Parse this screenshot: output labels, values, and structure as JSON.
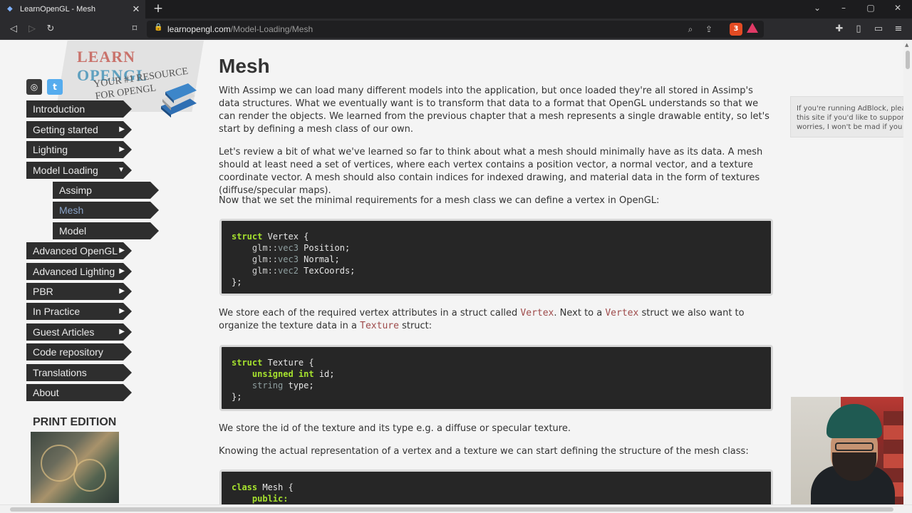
{
  "browser": {
    "tab_title": "LearnOpenGL - Mesh",
    "tab_close": "✕",
    "new_tab": "+",
    "url_domain": "learnopengl.com",
    "url_path": "/Model-Loading/Mesh",
    "brave_count": "3",
    "icons": [
      "back-icon",
      "forward-icon",
      "reload-icon",
      "bookmark-icon",
      "lock-icon",
      "zoom-icon",
      "share-icon",
      "brave-shields-icon",
      "rewards-icon",
      "extensions-icon",
      "sidebar-icon",
      "wallet-icon",
      "menu-icon"
    ]
  },
  "site": {
    "logo_learn": "LEARN ",
    "logo_opengl": "OPENGL",
    "logo_tagline_1": "YOUR #1 RESOURCE",
    "logo_tagline_2": "FOR OPENGL",
    "github_icon": "github-icon",
    "twitter_icon": "twitter-icon"
  },
  "nav": {
    "items": [
      {
        "label": "Introduction",
        "arrow": ""
      },
      {
        "label": "Getting started",
        "arrow": "▶"
      },
      {
        "label": "Lighting",
        "arrow": "▶"
      },
      {
        "label": "Model Loading",
        "arrow": "▼"
      },
      {
        "label": "Assimp",
        "arrow": ""
      },
      {
        "label": "Mesh",
        "arrow": ""
      },
      {
        "label": "Model",
        "arrow": ""
      },
      {
        "label": "Advanced OpenGL",
        "arrow": "▶"
      },
      {
        "label": "Advanced Lighting",
        "arrow": "▶"
      },
      {
        "label": "PBR",
        "arrow": "▶"
      },
      {
        "label": "In Practice",
        "arrow": "▶"
      },
      {
        "label": "Guest Articles",
        "arrow": "▶"
      },
      {
        "label": "Code repository",
        "arrow": ""
      },
      {
        "label": "Translations",
        "arrow": ""
      },
      {
        "label": "About",
        "arrow": ""
      }
    ],
    "print_edition": "PRINT EDITION"
  },
  "article": {
    "title": "Mesh",
    "p1": "With Assimp we can load many different models into the application, but once loaded they're all stored in Assimp's data structures. What we eventually want is to transform that data to a format that OpenGL understands so that we can render the objects. We learned from the previous chapter that a mesh represents a single drawable entity, so let's start by defining a mesh class of our own.",
    "p2": "Let's review a bit of what we've learned so far to think about what a mesh should minimally have as its data. A mesh should at least need a set of vertices, where each vertex contains a position vector, a normal vector, and a texture coordinate vector. A mesh should also contain indices for indexed drawing, and material data in the form of textures (diffuse/specular maps).",
    "p3": "Now that we set the minimal requirements for a mesh class we can define a vertex in OpenGL:",
    "p4_a": "We store each of the required vertex attributes in a struct called ",
    "p4_code1": "Vertex",
    "p4_b": ". Next to a ",
    "p4_code2": "Vertex",
    "p4_c": " struct we also want to organize the texture data in a ",
    "p4_code3": "Texture",
    "p4_d": " struct:",
    "p5": "We store the id of the texture and its type e.g. a diffuse or specular texture.",
    "p6": "Knowing the actual representation of a vertex and a texture we can start defining the structure of the mesh class:"
  },
  "code": {
    "vertex": {
      "kw_struct": "struct",
      "name": " Vertex {",
      "lines": [
        {
          "ns": "    glm::",
          "type": "vec3",
          "rest": " Position;"
        },
        {
          "ns": "    glm::",
          "type": "vec3",
          "rest": " Normal;"
        },
        {
          "ns": "    glm::",
          "type": "vec2",
          "rest": " TexCoords;"
        }
      ],
      "close": "};"
    },
    "texture": {
      "kw_struct": "struct",
      "name": " Texture {",
      "l1_kw": "    unsigned int",
      "l1_rest": " id;",
      "l2_type": "    string",
      "l2_rest": " type;",
      "close": "};"
    },
    "mesh": {
      "kw_class": "class",
      "name": " Mesh {",
      "l1": "    public:"
    }
  },
  "adblock": {
    "line1": "If you're running AdBlock, please",
    "line2": "this site if you'd like to support L",
    "line3": "worries, I won't be mad if you do"
  }
}
